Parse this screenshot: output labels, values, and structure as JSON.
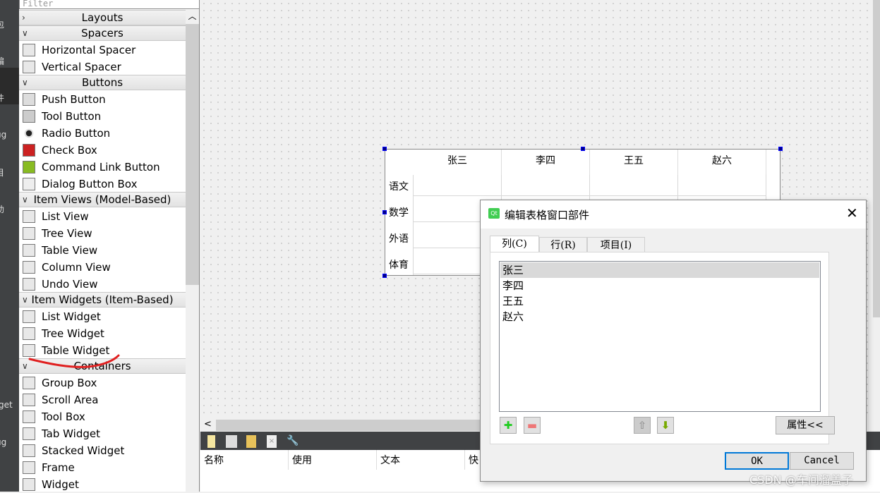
{
  "left_strip": {
    "labels": [
      "包",
      "编",
      "件",
      "ug",
      "目",
      "助",
      "get",
      "ug"
    ]
  },
  "widget_box": {
    "filter_placeholder": "Filter",
    "sections": [
      {
        "title": "Layouts",
        "collapsed": true,
        "items": []
      },
      {
        "title": "Spacers",
        "items": [
          {
            "label": "Horizontal Spacer",
            "icon": "horizontal-spacer-icon"
          },
          {
            "label": "Vertical Spacer",
            "icon": "vertical-spacer-icon"
          }
        ]
      },
      {
        "title": "Buttons",
        "items": [
          {
            "label": "Push Button",
            "icon": "push-button-icon"
          },
          {
            "label": "Tool Button",
            "icon": "tool-button-icon"
          },
          {
            "label": "Radio Button",
            "icon": "radio-button-icon"
          },
          {
            "label": "Check Box",
            "icon": "check-box-icon"
          },
          {
            "label": "Command Link Button",
            "icon": "command-link-icon"
          },
          {
            "label": "Dialog Button Box",
            "icon": "dialog-button-box-icon"
          }
        ]
      },
      {
        "title": "Item Views (Model-Based)",
        "items": [
          {
            "label": "List View"
          },
          {
            "label": "Tree View"
          },
          {
            "label": "Table View"
          },
          {
            "label": "Column View"
          },
          {
            "label": "Undo View"
          }
        ]
      },
      {
        "title": "Item Widgets (Item-Based)",
        "items": [
          {
            "label": "List Widget"
          },
          {
            "label": "Tree Widget"
          },
          {
            "label": "Table Widget"
          }
        ]
      },
      {
        "title": "Containers",
        "items": [
          {
            "label": "Group Box"
          },
          {
            "label": "Scroll Area"
          },
          {
            "label": "Tool Box"
          },
          {
            "label": "Tab Widget"
          },
          {
            "label": "Stacked Widget"
          },
          {
            "label": "Frame"
          },
          {
            "label": "Widget"
          }
        ]
      }
    ]
  },
  "table_widget": {
    "columns": [
      "张三",
      "李四",
      "王五",
      "赵六"
    ],
    "rows": [
      "语文",
      "数学",
      "外语",
      "体育"
    ]
  },
  "action_editor": {
    "columns": [
      "名称",
      "使用",
      "文本",
      "快"
    ]
  },
  "dialog": {
    "title": "编辑表格窗口部件",
    "tabs": [
      "列(C)",
      "行(R)",
      "项目(I)"
    ],
    "active_tab": 0,
    "items": [
      "张三",
      "李四",
      "王五",
      "赵六"
    ],
    "selected_index": 0,
    "properties_button": "属性<<",
    "ok": "OK",
    "cancel": "Cancel"
  },
  "watermark": "CSDN @车间溜盖子",
  "colors": {
    "annotation": "#e02020",
    "selection_handle": "#000080",
    "ok_border": "#0078d7"
  }
}
